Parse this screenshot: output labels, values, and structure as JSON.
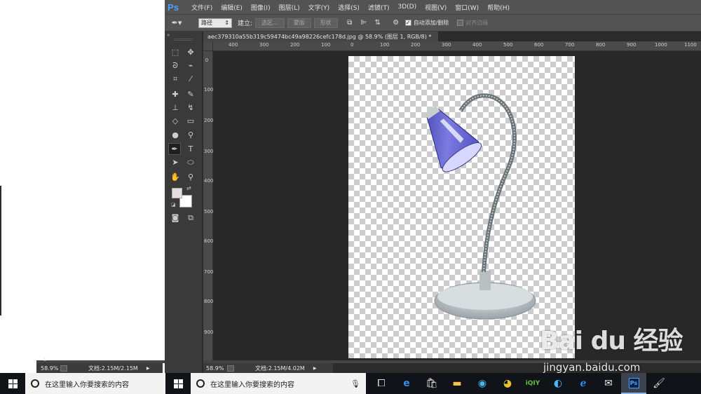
{
  "left_window": {
    "ruler_mark": "1",
    "status": {
      "zoom": "58.9%",
      "doc": "文档:2.15M/2.15M"
    }
  },
  "photoshop": {
    "logo": "Ps",
    "menu": [
      "文件(F)",
      "编辑(E)",
      "图像(I)",
      "图层(L)",
      "文字(Y)",
      "选择(S)",
      "滤镜(T)",
      "3D(D)",
      "视图(V)",
      "窗口(W)",
      "帮助(H)"
    ],
    "options": {
      "mode_value": "路径",
      "make_label": "建立:",
      "selection_btn": "选区...",
      "mask_btn": "蒙版",
      "shape_btn": "形状",
      "auto_add_delete": "自动添加/删除",
      "align_edges": "对齐边缘"
    },
    "doc_tab": {
      "title": "aec379310a55b319c59474bc49a98226cefc178d.jpg @ 58.9% (图层 1, RGB/8) *",
      "close": "×"
    },
    "ruler_top_labels": [
      "400",
      "300",
      "200",
      "100",
      "0",
      "100",
      "200",
      "300",
      "400",
      "500",
      "600",
      "700",
      "800",
      "900",
      "1000",
      "1100"
    ],
    "ruler_left_labels": [
      "0",
      "100",
      "200",
      "300",
      "400",
      "500",
      "600",
      "700",
      "800",
      "900"
    ],
    "status": {
      "zoom": "58.9%",
      "doc": "文档:2.15M/4.02M"
    }
  },
  "watermark": {
    "main": "Bai du 经验",
    "url": "jingyan.baidu.com"
  },
  "taskbar": {
    "search_placeholder": "在这里输入你要搜索的内容",
    "apps": [
      "task-view-icon",
      "edge-icon",
      "store-icon",
      "file-explorer-icon",
      "browser-360-icon",
      "browser-yellow-icon",
      "iqiyi-icon",
      "qq-browser-icon",
      "ie-icon",
      "mail-icon",
      "photoshop-icon",
      "paint-icon"
    ]
  }
}
